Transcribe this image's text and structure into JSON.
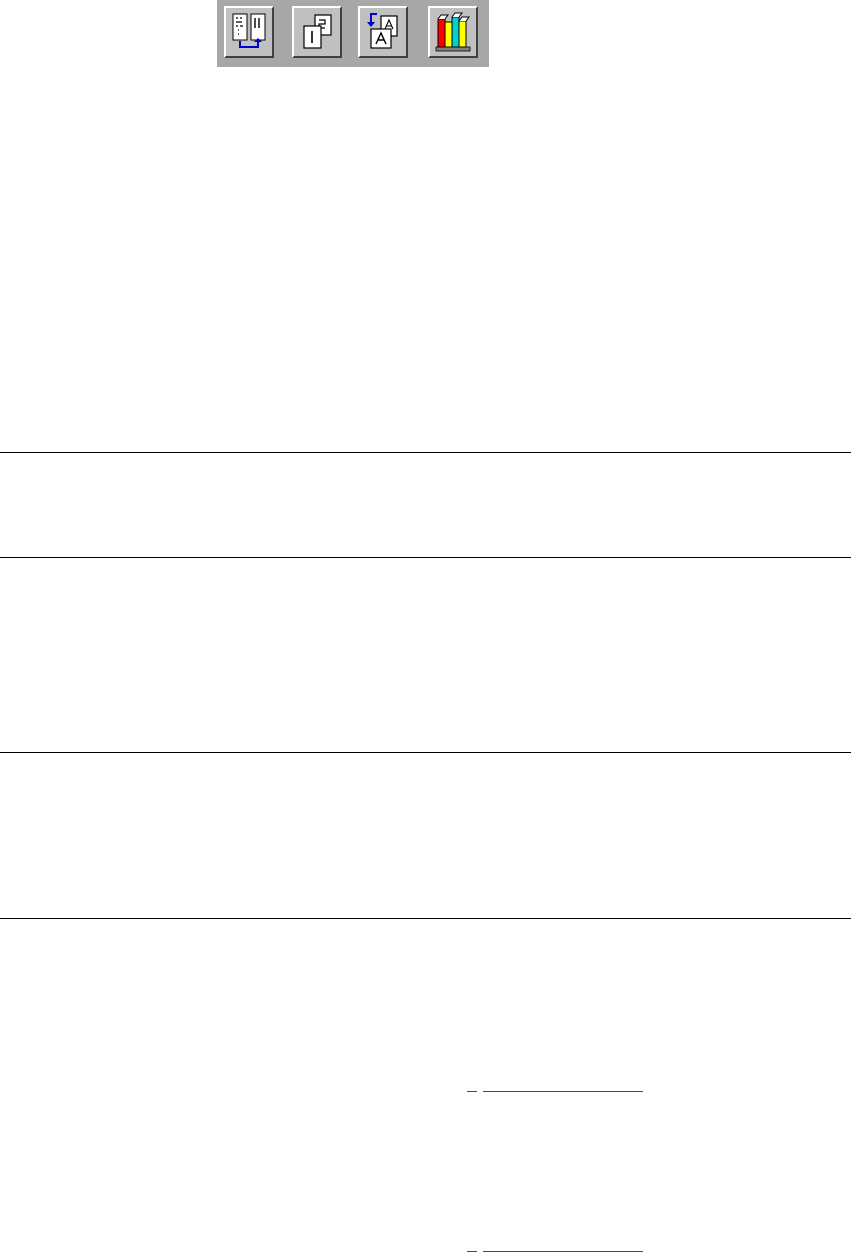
{
  "toolbar": {
    "buttons": [
      {
        "name": "compare-pages",
        "icon": "two-pages-arrow-icon"
      },
      {
        "name": "numbered-pages",
        "icon": "stacked-pages-icon"
      },
      {
        "name": "rotate-document",
        "icon": "document-rotate-icon"
      },
      {
        "name": "library",
        "icon": "books-icon"
      }
    ]
  },
  "colors": {
    "toolbar_bg": "#a7a7a7",
    "button_face": "#c0c0c0",
    "link": "#ff0000",
    "rule": "#000000"
  }
}
